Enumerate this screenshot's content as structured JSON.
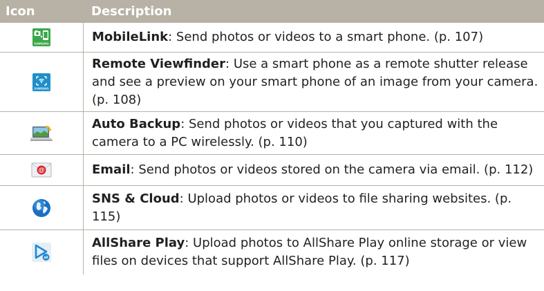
{
  "header": {
    "icon": "Icon",
    "description": "Description"
  },
  "rows": [
    {
      "icon": "mobilelink-icon",
      "title": "MobileLink",
      "text": ": Send photos or videos to a smart phone. (p. 107)"
    },
    {
      "icon": "remote-viewfinder-icon",
      "title": "Remote Viewfinder",
      "text": ": Use a smart phone as a remote shutter release and see a preview on your smart phone of an image from your camera. (p. 108)"
    },
    {
      "icon": "auto-backup-icon",
      "title": "Auto Backup",
      "text": ": Send photos or videos that you captured with the camera to a PC wirelessly. (p. 110)"
    },
    {
      "icon": "email-icon",
      "title": "Email",
      "text": ": Send photos or videos stored on the camera via email. (p. 112)"
    },
    {
      "icon": "sns-cloud-icon",
      "title": "SNS & Cloud",
      "text": ": Upload photos or videos to file sharing websites. (p. 115)"
    },
    {
      "icon": "allshare-play-icon",
      "title": "AllShare Play",
      "text": ": Upload photos to AllShare Play online storage or view files on devices that support AllShare Play. (p. 117)"
    }
  ],
  "icon_labels": {
    "samsung": "SAMSUNG"
  },
  "colors": {
    "header_bg": "#b8b2a6",
    "rule": "#b8b2a6",
    "samsung_green": "#3aa84a",
    "samsung_blue": "#1f8fc9"
  }
}
